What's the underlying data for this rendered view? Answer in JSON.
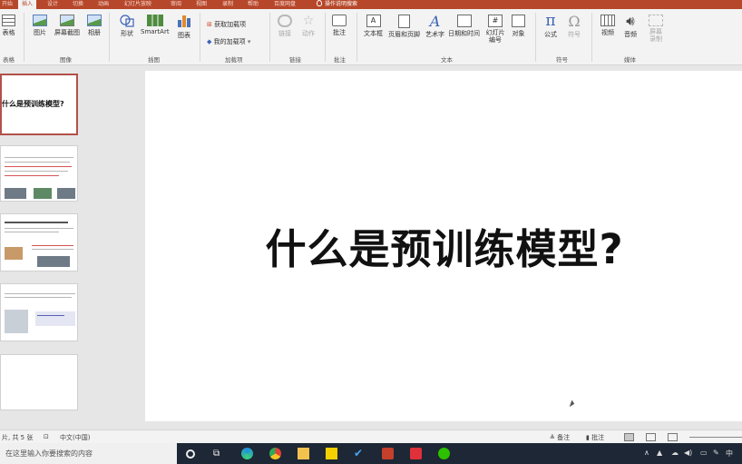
{
  "tabs": {
    "items": [
      "开始",
      "插入",
      "设计",
      "切换",
      "动画",
      "幻灯片放映",
      "审阅",
      "视图",
      "录制",
      "帮助",
      "百度网盘"
    ],
    "active_index": 1,
    "search": "操作说明搜索"
  },
  "ribbon": {
    "table": "表格",
    "picture": "图片",
    "screenshot": "屏幕截图",
    "album": "相册",
    "shapes": "形状",
    "smartart": "SmartArt",
    "chart": "图表",
    "get_addins": "获取加载项",
    "my_addins": "我的加载项",
    "link": "链接",
    "action": "动作",
    "comment": "批注",
    "textbox": "文本框",
    "header_footer": "页眉和页脚",
    "wordart": "艺术字",
    "datetime": "日期和时间",
    "slide_number": "幻灯片编号",
    "object": "对象",
    "equation": "公式",
    "symbol": "符号",
    "video": "视频",
    "audio": "音频",
    "screen_recording": "屏幕录制"
  },
  "groups": {
    "tables": "表格",
    "images": "图像",
    "illustrations": "插图",
    "addins": "加载项",
    "links": "链接",
    "comments": "批注",
    "text": "文本",
    "symbols": "符号",
    "media": "媒体"
  },
  "thumbnails": {
    "slide1_title": "什么是预训练模型?"
  },
  "slide": {
    "title": "什么是预训练模型?"
  },
  "status": {
    "slide_count": "片, 共 5 张",
    "language": "中文(中国)",
    "notes": "备注",
    "comments": "批注"
  },
  "taskbar": {
    "search_placeholder": "在这里输入你要搜索的内容",
    "tray_text": "中"
  }
}
